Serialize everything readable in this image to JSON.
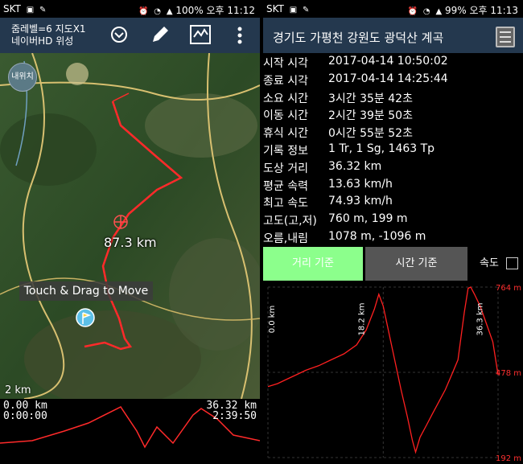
{
  "left_status": {
    "carrier": "SKT",
    "battery": "100%",
    "time": "오후 11:12"
  },
  "right_status": {
    "carrier": "SKT",
    "battery": "99%",
    "time": "오후 11:13"
  },
  "map_screen": {
    "zoom_line": "줌레벨=6 지도X1",
    "map_type": "네이버HD 위성",
    "icons": [
      "chevron-down-icon",
      "pencil-icon",
      "map-icon",
      "more-icon"
    ],
    "here_button": "내위치",
    "distance_label": "87.3 km",
    "toast": "Touch & Drag to Move",
    "scale": "2 km",
    "mini_graph": {
      "dist_start": "0.00 km",
      "time_start": "0:00:00",
      "dist_end": "36.32 km",
      "time_end": "2:39:50"
    }
  },
  "stats_screen": {
    "title": "경기도 가평천 강원도 광덕산 계곡",
    "rows": [
      {
        "k": "시작 시각",
        "v": "2017-04-14 10:50:02"
      },
      {
        "k": "종료 시각",
        "v": "2017-04-14 14:25:44"
      },
      {
        "k": "소요 시간",
        "v": "3시간 35분 42초"
      },
      {
        "k": "이동 시간",
        "v": "2시간 39분 50초"
      },
      {
        "k": "휴식 시간",
        "v": "0시간 55분 52초"
      },
      {
        "k": "기록 정보",
        "v": "1 Tr, 1 Sg, 1463 Tp"
      },
      {
        "k": "도상 거리",
        "v": "36.32 km"
      },
      {
        "k": "평균 속력",
        "v": "13.63 km/h"
      },
      {
        "k": "최고 속도",
        "v": "74.93 km/h"
      },
      {
        "k": "고도(고,저)",
        "v": "760 m, 199 m"
      },
      {
        "k": "오름,내림",
        "v": "1078 m, -1096 m"
      }
    ],
    "tabs": {
      "distance": "거리 기준",
      "time": "시간 기준",
      "speed": "속도"
    },
    "colors": {
      "active_tab": "#8cff8c",
      "inactive_tab": "#555555",
      "line": "#ff2020"
    }
  },
  "chart_data": {
    "type": "line",
    "title": "",
    "xlabel": "",
    "ylabel": "",
    "x_unit": "km",
    "x_ticks": [
      "0.0 km",
      "18.2 km",
      "36.3 km"
    ],
    "y_ticks": [
      "764 m",
      "478 m",
      "192 m"
    ],
    "ylim": [
      192,
      764
    ],
    "xlim": [
      0,
      36.32
    ],
    "grid": true,
    "series": [
      {
        "x": [
          0,
          1.5,
          3,
          4.5,
          6,
          8,
          10,
          12,
          14,
          15.5,
          16.8,
          17.5,
          18.2,
          19,
          20,
          21,
          22,
          22.8,
          23.3,
          24,
          25,
          26,
          27,
          28,
          29,
          30,
          31,
          31.6,
          32,
          32.6,
          33.5,
          34.5,
          35.5,
          36.32
        ],
        "y": [
          430,
          440,
          455,
          470,
          485,
          500,
          520,
          540,
          570,
          620,
          690,
          740,
          700,
          620,
          520,
          420,
          330,
          250,
          210,
          260,
          300,
          340,
          380,
          420,
          470,
          520,
          680,
          760,
          764,
          740,
          700,
          640,
          580,
          470
        ]
      }
    ]
  }
}
